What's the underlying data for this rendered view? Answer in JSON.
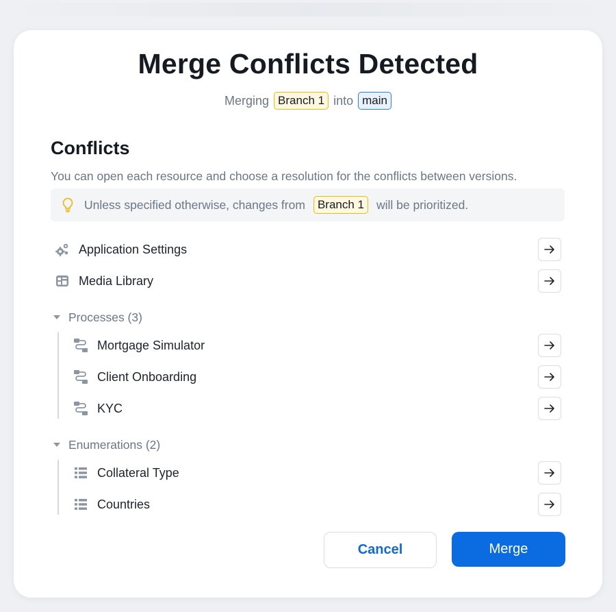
{
  "dialog": {
    "title": "Merge Conflicts Detected",
    "subtitle": {
      "prefix": "Merging",
      "source_branch": "Branch 1",
      "middle": "into",
      "target_branch": "main"
    }
  },
  "conflicts": {
    "heading": "Conflicts",
    "description": "You can open each resource and choose a resolution for the conflicts between versions.",
    "info": {
      "prefix": "Unless specified otherwise, changes from",
      "branch": "Branch 1",
      "suffix": "will be prioritized.",
      "icon": "lightbulb-icon"
    }
  },
  "resources": [
    {
      "label": "Application Settings",
      "icon": "gears-icon"
    },
    {
      "label": "Media Library",
      "icon": "media-library-icon"
    }
  ],
  "groups": [
    {
      "label": "Processes (3)",
      "items": [
        {
          "label": "Mortgage Simulator",
          "icon": "process-icon"
        },
        {
          "label": "Client Onboarding",
          "icon": "process-icon"
        },
        {
          "label": "KYC",
          "icon": "process-icon"
        }
      ]
    },
    {
      "label": "Enumerations (2)",
      "items": [
        {
          "label": "Collateral Type",
          "icon": "list-icon"
        },
        {
          "label": "Countries",
          "icon": "list-icon"
        }
      ]
    }
  ],
  "actions": {
    "cancel_label": "Cancel",
    "merge_label": "Merge"
  },
  "colors": {
    "primary": "#0a6ce0",
    "branch_chip": "#f3b81e",
    "main_chip": "#2f80d8",
    "muted_text": "#6b7686"
  }
}
